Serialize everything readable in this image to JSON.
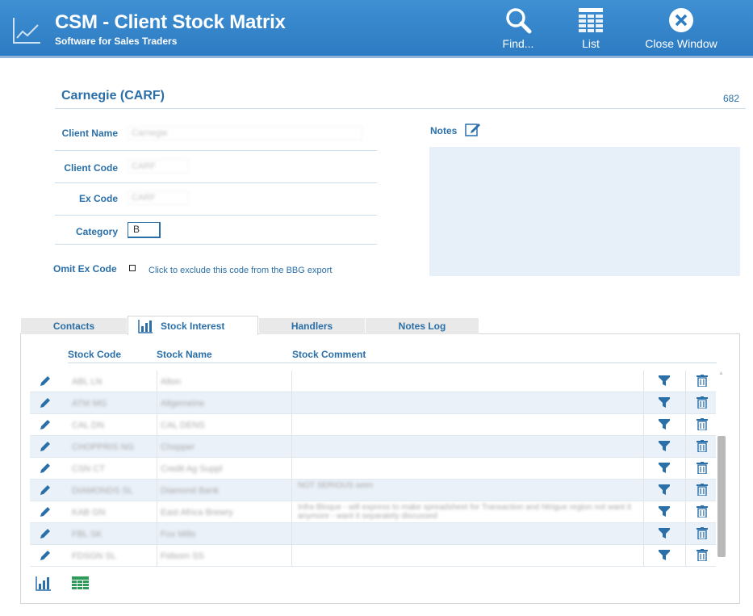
{
  "header": {
    "logo_icon": "line-chart-icon",
    "title": "CSM - Client Stock Matrix",
    "subtitle": "Software for Sales Traders",
    "buttons": [
      {
        "label": "Find...",
        "icon": "search-icon"
      },
      {
        "label": "List",
        "icon": "list-icon"
      },
      {
        "label": "Close Window",
        "icon": "close-icon"
      }
    ]
  },
  "client": {
    "heading": "Carnegie (CARF)",
    "record_number": "682"
  },
  "form": {
    "client_name_label": "Client Name",
    "client_name_value": "Carnegie",
    "client_code_label": "Client Code",
    "client_code_value": "CARF",
    "ex_code_label": "Ex Code",
    "ex_code_value": "CARF",
    "category_label": "Category",
    "category_value": "B",
    "omit_label": "Omit Ex Code",
    "omit_checked": false,
    "omit_hint": "Click to exclude this code from the BBG export"
  },
  "notes": {
    "label": "Notes",
    "edit_icon": "edit-icon",
    "value": ""
  },
  "tabs": [
    {
      "label": "Contacts",
      "active": false
    },
    {
      "label": "Stock Interest",
      "active": true,
      "icon": "bar-chart-icon"
    },
    {
      "label": "Handlers",
      "active": false
    },
    {
      "label": "Notes Log",
      "active": false
    }
  ],
  "grid": {
    "columns": [
      "Stock Code",
      "Stock Name",
      "Stock Comment"
    ],
    "rows": [
      {
        "code": "ABL LN",
        "name": "Alton",
        "comment": ""
      },
      {
        "code": "ATM MG",
        "name": "Allgemeine",
        "comment": ""
      },
      {
        "code": "CAL DN",
        "name": "CAL DENS",
        "comment": ""
      },
      {
        "code": "CHOPPRIS NG",
        "name": "Chopper",
        "comment": ""
      },
      {
        "code": "CSN CT",
        "name": "Credit Ag Suppl",
        "comment": ""
      },
      {
        "code": "DIAMONDS SL",
        "name": "Diamond Bank",
        "comment": "NOT SERIOUS seen"
      },
      {
        "code": "KAB GN",
        "name": "East Africa Brewry",
        "comment": "Infra Bloque - will express to make spreadsheet for Transaction and Ntrigue region not want it anymore - want it separately discussed"
      },
      {
        "code": "FBL SK",
        "name": "Fox Mills",
        "comment": ""
      },
      {
        "code": "FDSGN SL",
        "name": "Fidsom SS",
        "comment": ""
      }
    ],
    "row_icons": {
      "edit": "pencil-icon",
      "filter": "filter-icon",
      "delete": "trash-icon"
    }
  },
  "footer_icons": [
    "bar-chart-icon",
    "table-icon"
  ],
  "colors": {
    "header": "#2d7cc3",
    "accent": "#2a6fa8",
    "notes_bg": "#e7eff8",
    "row_alt": "#eaf1f9",
    "table_icon": "#2e9a5a"
  }
}
